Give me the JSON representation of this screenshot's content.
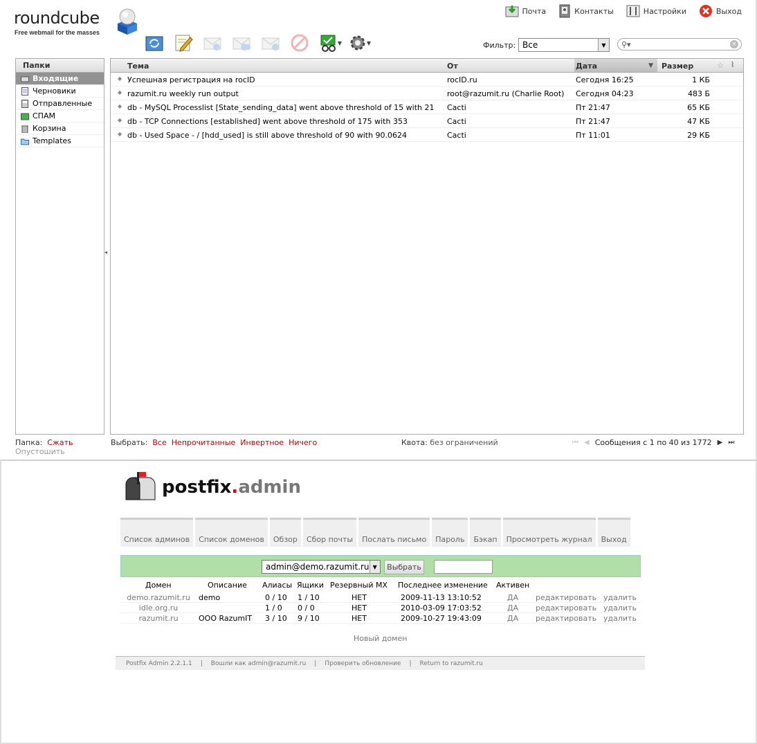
{
  "app": {
    "brand": "roundcube",
    "tagline": "Free webmail for the masses"
  },
  "top_nav": [
    {
      "label": "Почта",
      "icon": "mail-inbox-icon"
    },
    {
      "label": "Контакты",
      "icon": "address-book-icon"
    },
    {
      "label": "Настройки",
      "icon": "settings-panel-icon"
    },
    {
      "label": "Выход",
      "icon": "logout-icon"
    }
  ],
  "toolbar": [
    {
      "name": "check-mail-button",
      "icon": "refresh-mail-icon",
      "enabled": true
    },
    {
      "name": "compose-button",
      "icon": "compose-icon",
      "enabled": true
    },
    {
      "name": "reply-button",
      "icon": "reply-icon",
      "enabled": false
    },
    {
      "name": "reply-all-button",
      "icon": "reply-all-icon",
      "enabled": false
    },
    {
      "name": "forward-button",
      "icon": "forward-icon",
      "enabled": false
    },
    {
      "name": "delete-button",
      "icon": "delete-icon",
      "enabled": false
    },
    {
      "name": "mark-button",
      "icon": "mark-icon",
      "enabled": true
    },
    {
      "name": "more-button",
      "icon": "gear-icon",
      "enabled": true
    }
  ],
  "filter": {
    "label": "Фильтр:",
    "value": "Все"
  },
  "search": {
    "value": ""
  },
  "folders": {
    "title": "Папки",
    "items": [
      {
        "label": "Входящие",
        "selected": true,
        "icon": "inbox-icon"
      },
      {
        "label": "Черновики",
        "selected": false,
        "icon": "drafts-icon"
      },
      {
        "label": "Отправленные",
        "selected": false,
        "icon": "sent-icon"
      },
      {
        "label": "СПАМ",
        "selected": false,
        "icon": "spam-icon"
      },
      {
        "label": "Корзина",
        "selected": false,
        "icon": "trash-icon"
      },
      {
        "label": "Templates",
        "selected": false,
        "icon": "folder-icon"
      }
    ]
  },
  "message_list": {
    "columns": {
      "subject": "Тема",
      "from": "От",
      "date": "Дата",
      "size": "Размер"
    },
    "rows": [
      {
        "subject": "Успешная регистрация на rocID",
        "from": "rocID.ru",
        "date": "Сегодня 16:25",
        "size": "1 КБ"
      },
      {
        "subject": "razumit.ru weekly run output",
        "from": "root@razumit.ru (Charlie Root)",
        "date": "Сегодня 04:23",
        "size": "483 Б"
      },
      {
        "subject": "db - MySQL Processlist [State_sending_data] went above threshold of 15 with 21",
        "from": "Cacti",
        "date": "Пт 21:47",
        "size": "65 КБ"
      },
      {
        "subject": "db - TCP Connections [established] went above threshold of 175 with 353",
        "from": "Cacti",
        "date": "Пт 21:47",
        "size": "47 КБ"
      },
      {
        "subject": "db - Used Space - / [hdd_used] is still above threshold of 90 with 90.0624",
        "from": "Cacti",
        "date": "Пт 11:01",
        "size": "29 КБ"
      }
    ]
  },
  "footer": {
    "folder_label": "Папка:",
    "compact": "Сжать",
    "empty": "Опустошить",
    "select_label": "Выбрать:",
    "select_all": "Все",
    "select_unread": "Непрочитанные",
    "select_invert": "Инвертное",
    "select_none": "Ничего",
    "quota_label": "Квота:",
    "quota_value": "без ограничений",
    "count_text": "Сообщения с 1 по 40 из 1772"
  },
  "postfix": {
    "logo_main": "postfix",
    "logo_dot": ".",
    "logo_sub": "admin",
    "menu": [
      "Список админов",
      "Список доменов",
      "Обзор",
      "Сбор почты",
      "Послать письмо",
      "Пароль",
      "Бэкап",
      "Просмотреть журнал",
      "Выход"
    ],
    "selector": {
      "value": "admin@demo.razumit.ru",
      "button": "Выбрать",
      "input": ""
    },
    "table": {
      "headers": [
        "Домен",
        "Описание",
        "Алиасы",
        "Ящики",
        "Резервный MX",
        "Последнее изменение",
        "Активен"
      ],
      "rows": [
        {
          "domain": "demo.razumit.ru",
          "desc": "demo",
          "aliases": "0 / 10",
          "mailboxes": "1 / 10",
          "mx": "НЕТ",
          "modified": "2009-11-13 13:10:52",
          "active": "ДА",
          "edit": "редактировать",
          "delete": "удалить"
        },
        {
          "domain": "idle.org.ru",
          "desc": "",
          "aliases": "1 / 0",
          "mailboxes": "0 / 0",
          "mx": "НЕТ",
          "modified": "2010-03-09 17:03:52",
          "active": "ДА",
          "edit": "редактировать",
          "delete": "удалить"
        },
        {
          "domain": "razumit.ru",
          "desc": "ООО RazumIT",
          "aliases": "3 / 10",
          "mailboxes": "9 / 10",
          "mx": "НЕТ",
          "modified": "2009-10-27 19:43:09",
          "active": "ДА",
          "edit": "редактировать",
          "delete": "удалить"
        }
      ]
    },
    "new_domain": "Новый домен",
    "footer": [
      "Postfix Admin 2.2.1.1",
      "Вошли как admin@razumit.ru",
      "Проверить обновление",
      "Return to razumit.ru"
    ]
  }
}
